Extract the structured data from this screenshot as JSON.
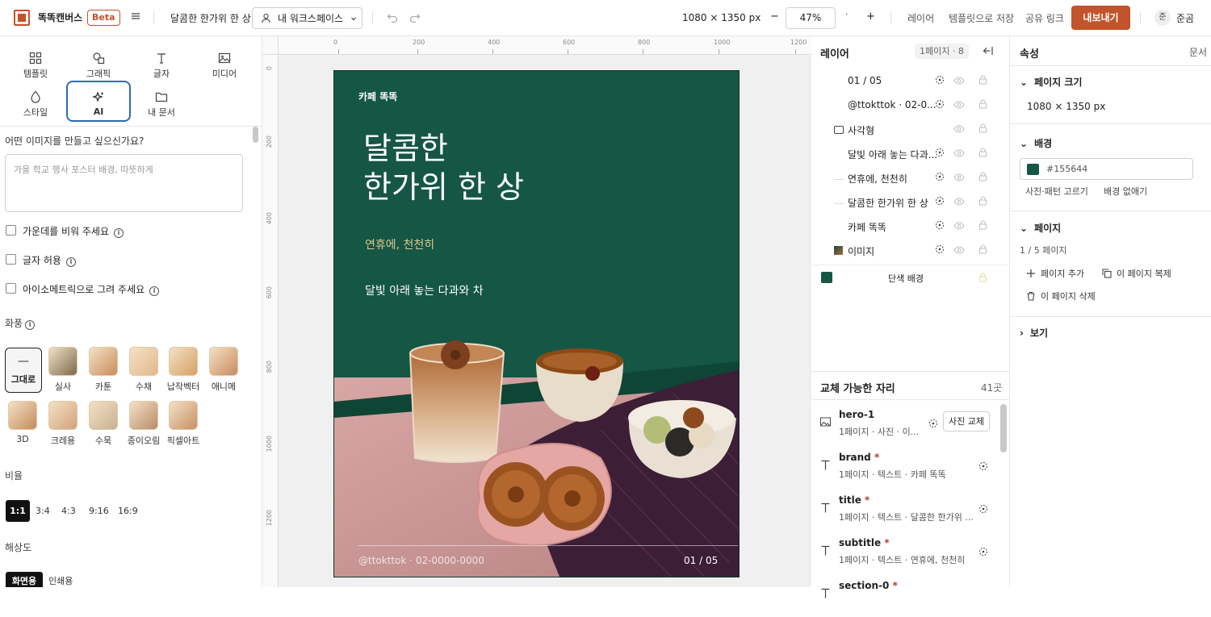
{
  "app": {
    "name": "똑똑캔버스",
    "badge": "Beta",
    "doc_title": "달콤한 한가위 한 상",
    "workspace": "내 워크스페이스",
    "canvas_size": "1080 × 1350 px",
    "zoom": "47%",
    "menu_layers": "레이어",
    "menu_save_template": "템플릿으로 저장",
    "menu_share": "공유 링크",
    "export": "내보내기",
    "user_initial": "준",
    "user_name": "준곰",
    "zoom_minus": "−",
    "zoom_plus": "+"
  },
  "tools": [
    {
      "label": "템플릿"
    },
    {
      "label": "그래픽"
    },
    {
      "label": "글자"
    },
    {
      "label": "미디어"
    },
    {
      "label": "스타일"
    },
    {
      "label": "AI"
    },
    {
      "label": "내 문서"
    }
  ],
  "ai_panel": {
    "prompt_label": "어떤 이미지를 만들고 싶으신가요?",
    "prompt_placeholder": "가을 학교 행사 포스터 배경, 따뜻하게",
    "opt_center": "가운데를 비워 주세요",
    "opt_text": "글자 허용",
    "opt_iso": "아이소메트릭으로 그려 주세요",
    "style_label": "화풍",
    "styles": [
      "그대로",
      "실사",
      "카툰",
      "수채",
      "납작벡터",
      "애니메",
      "3D",
      "크레용",
      "수묵",
      "종이오림",
      "픽셀아트"
    ],
    "ratio_label": "비율",
    "ratios": [
      "1:1",
      "3:4",
      "4:3",
      "9:16",
      "16:9"
    ],
    "res_label": "해상도",
    "res_options": [
      "화면용",
      "인쇄용"
    ]
  },
  "rulers": {
    "h": [
      "0",
      "200",
      "400",
      "600",
      "800",
      "1000",
      "1200"
    ],
    "v": [
      "0",
      "200",
      "400",
      "600",
      "800",
      "1000",
      "1200"
    ]
  },
  "poster": {
    "brand": "카페 똑똑",
    "title_line1": "달콤한",
    "title_line2": "한가위 한 상",
    "subtitle": "연휴에, 천천히",
    "section": "달빛 아래 놓는 다과와 차",
    "contact": "@ttokttok · 02-0000-0000",
    "page": "01 / 05",
    "bg": "#155644"
  },
  "layers": {
    "title": "레이어",
    "page_info": "1페이지 · 8",
    "items": [
      "01 / 05",
      "@ttokttok · 02-0...",
      "사각형",
      "달빛 아래 놓는 다과...",
      "연휴에, 천천히",
      "달콤한 한가위 한 상",
      "카페 똑똑",
      "이미지"
    ],
    "background": "단색 배경"
  },
  "placeholders": {
    "title": "교체 가능한 자리",
    "count": "41곳",
    "replace_btn": "사진 교체",
    "items": [
      {
        "name": "hero-1",
        "req": "",
        "desc": "1페이지 · 사진 · 이..."
      },
      {
        "name": "brand",
        "req": "*",
        "desc": "1페이지 · 텍스트 · 카페 똑똑"
      },
      {
        "name": "title",
        "req": "*",
        "desc": "1페이지 · 텍스트 · 달콤한 한가위 ..."
      },
      {
        "name": "subtitle",
        "req": "*",
        "desc": "1페이지 · 텍스트 · 연휴에, 천천히"
      },
      {
        "name": "section-0",
        "req": "*",
        "desc": ""
      }
    ]
  },
  "properties": {
    "title": "속성",
    "doc_link": "문서",
    "page_size_label": "페이지 크기",
    "page_size": "1080 × 1350 px",
    "bg_label": "배경",
    "bg_color": "#155644",
    "photo_pattern": "사진·패턴 고르기",
    "remove_bg": "배경 없애기",
    "page_label": "페이지",
    "page_count": "1 / 5 페이지",
    "add_page": "페이지 추가",
    "dup_page": "이 페이지 복제",
    "del_page": "이 페이지 삭제",
    "view_label": "보기"
  }
}
